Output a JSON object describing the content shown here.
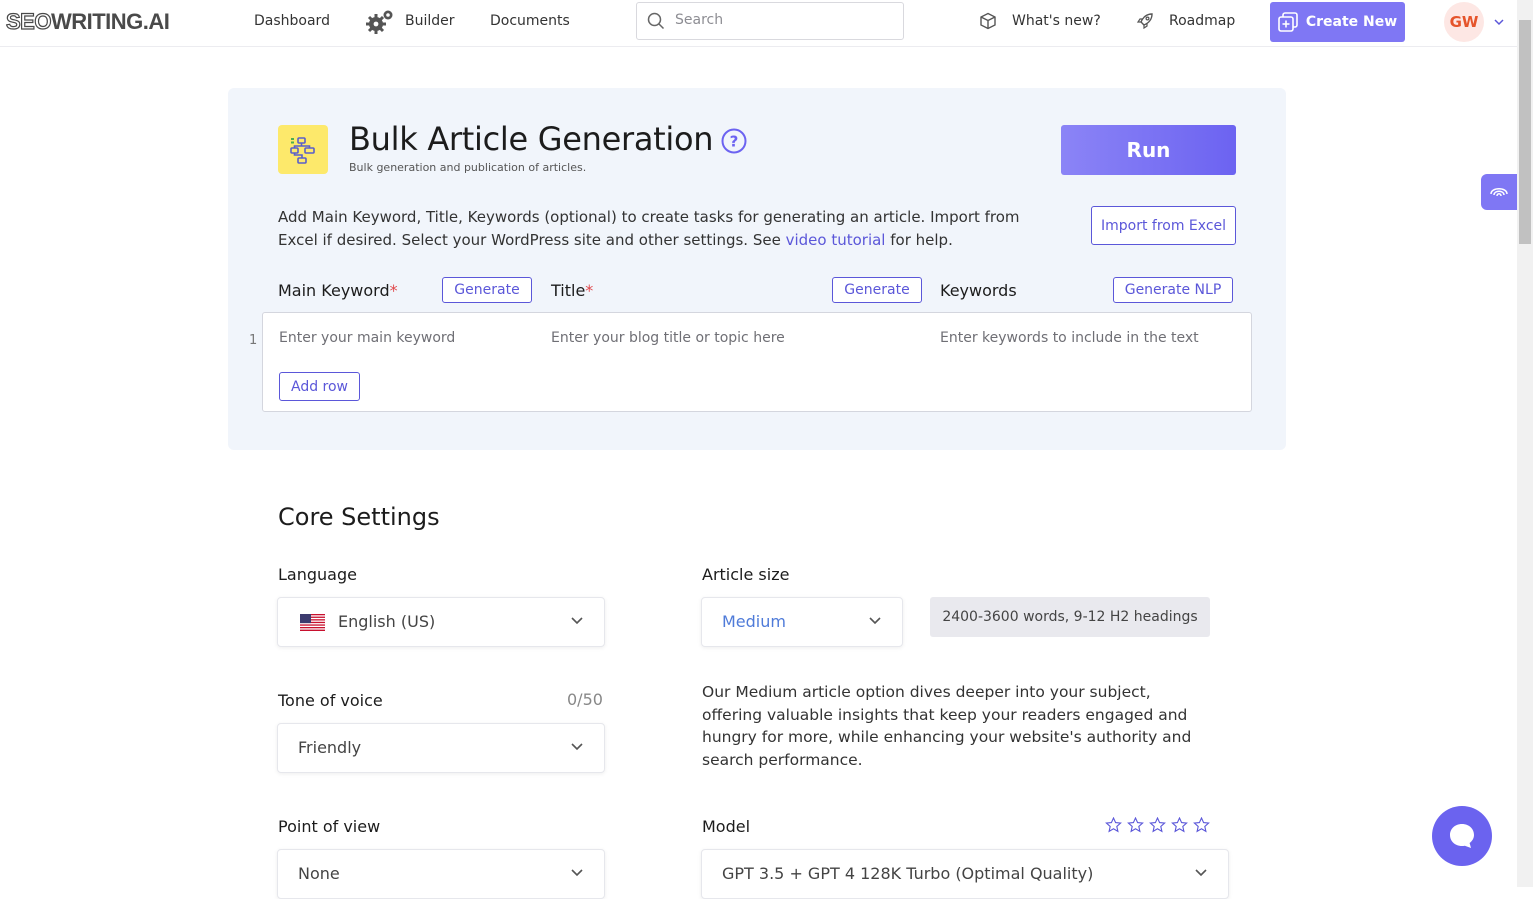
{
  "nav": {
    "logo_light": "SEO",
    "logo_bold": "WRITING.AI",
    "dashboard": "Dashboard",
    "builder": "Builder",
    "documents": "Documents",
    "search_placeholder": "Search",
    "whats_new": "What's new?",
    "roadmap": "Roadmap",
    "create_new": "Create New",
    "avatar_initials": "GW"
  },
  "bulk": {
    "title": "Bulk Article Generation",
    "subtitle": "Bulk generation and publication of articles.",
    "run": "Run",
    "desc_part1": "Add Main Keyword, Title, Keywords (optional) to create tasks for generating an article. Import from Excel if desired. Select your WordPress site and other settings. See ",
    "desc_link": "video tutorial",
    "desc_part2": " for help.",
    "import_excel": "Import from Excel",
    "columns": {
      "main_keyword": "Main Keyword",
      "title": "Title",
      "keywords": "Keywords",
      "required_mark": "*"
    },
    "buttons": {
      "generate_keyword": "Generate",
      "generate_title": "Generate",
      "generate_nlp": "Generate NLP",
      "add_row": "Add row"
    },
    "row_number": "1",
    "placeholders": {
      "main_keyword": "Enter your main keyword",
      "title": "Enter your blog title or topic here",
      "keywords": "Enter keywords to include in the text"
    }
  },
  "core": {
    "title": "Core Settings",
    "language_label": "Language",
    "language_value": "English (US)",
    "tone_label": "Tone of voice",
    "tone_counter": "0/50",
    "tone_value": "Friendly",
    "pov_label": "Point of view",
    "pov_value": "None",
    "size_label": "Article size",
    "size_value": "Medium",
    "size_info": "2400-3600 words, 9-12 H2 headings",
    "size_desc": "Our Medium article option dives deeper into your subject, offering valuable insights that keep your readers engaged and hungry for more, while enhancing your website's authority and search performance.",
    "model_label": "Model",
    "model_value": "GPT 3.5 + GPT 4 128K Turbo (Optimal Quality)",
    "model_stars_filled": 0,
    "model_stars_total": 5
  },
  "colors": {
    "accent": "#7f77f4",
    "link": "#5b57d9",
    "card_bg": "#f1f5fb",
    "required": "#e0484b",
    "avatar_bg": "#fde7e4",
    "avatar_text": "#e5542b",
    "icon_yellow": "#fde96b"
  }
}
